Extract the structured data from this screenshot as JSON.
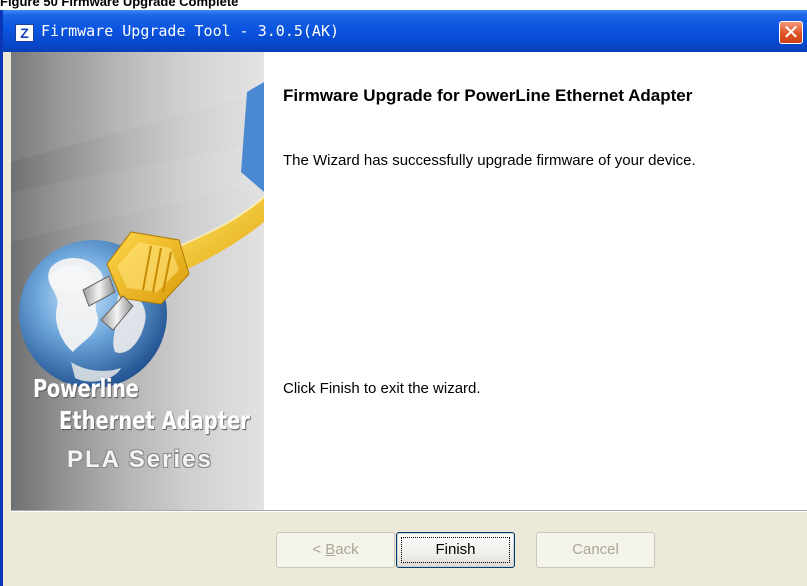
{
  "caption": "Figure 50 Firmware Upgrade Complete",
  "window": {
    "title": "Firmware Upgrade Tool - 3.0.5(AK)",
    "app_icon_letter": "Z",
    "close_glyph": "✕"
  },
  "banner": {
    "brand_line1": "Powerline",
    "brand_line2": "Ethernet Adapter",
    "series": "PLA Series"
  },
  "content": {
    "heading": "Firmware Upgrade for PowerLine Ethernet Adapter",
    "message": "The Wizard has successfully upgrade firmware of your device.",
    "finish_message": "Click Finish to exit the wizard."
  },
  "buttons": {
    "back_prefix": "< ",
    "back_mnemonic": "B",
    "back_rest": "ack",
    "finish": "Finish",
    "cancel": "Cancel"
  },
  "colors": {
    "titlebar": "#0a55e0",
    "close_button": "#e05425",
    "dialog_face": "#ece9d8",
    "cord": "#f0c020"
  },
  "icons": [
    "app-logo-icon",
    "close-icon",
    "power-plug-icon",
    "globe-icon"
  ]
}
